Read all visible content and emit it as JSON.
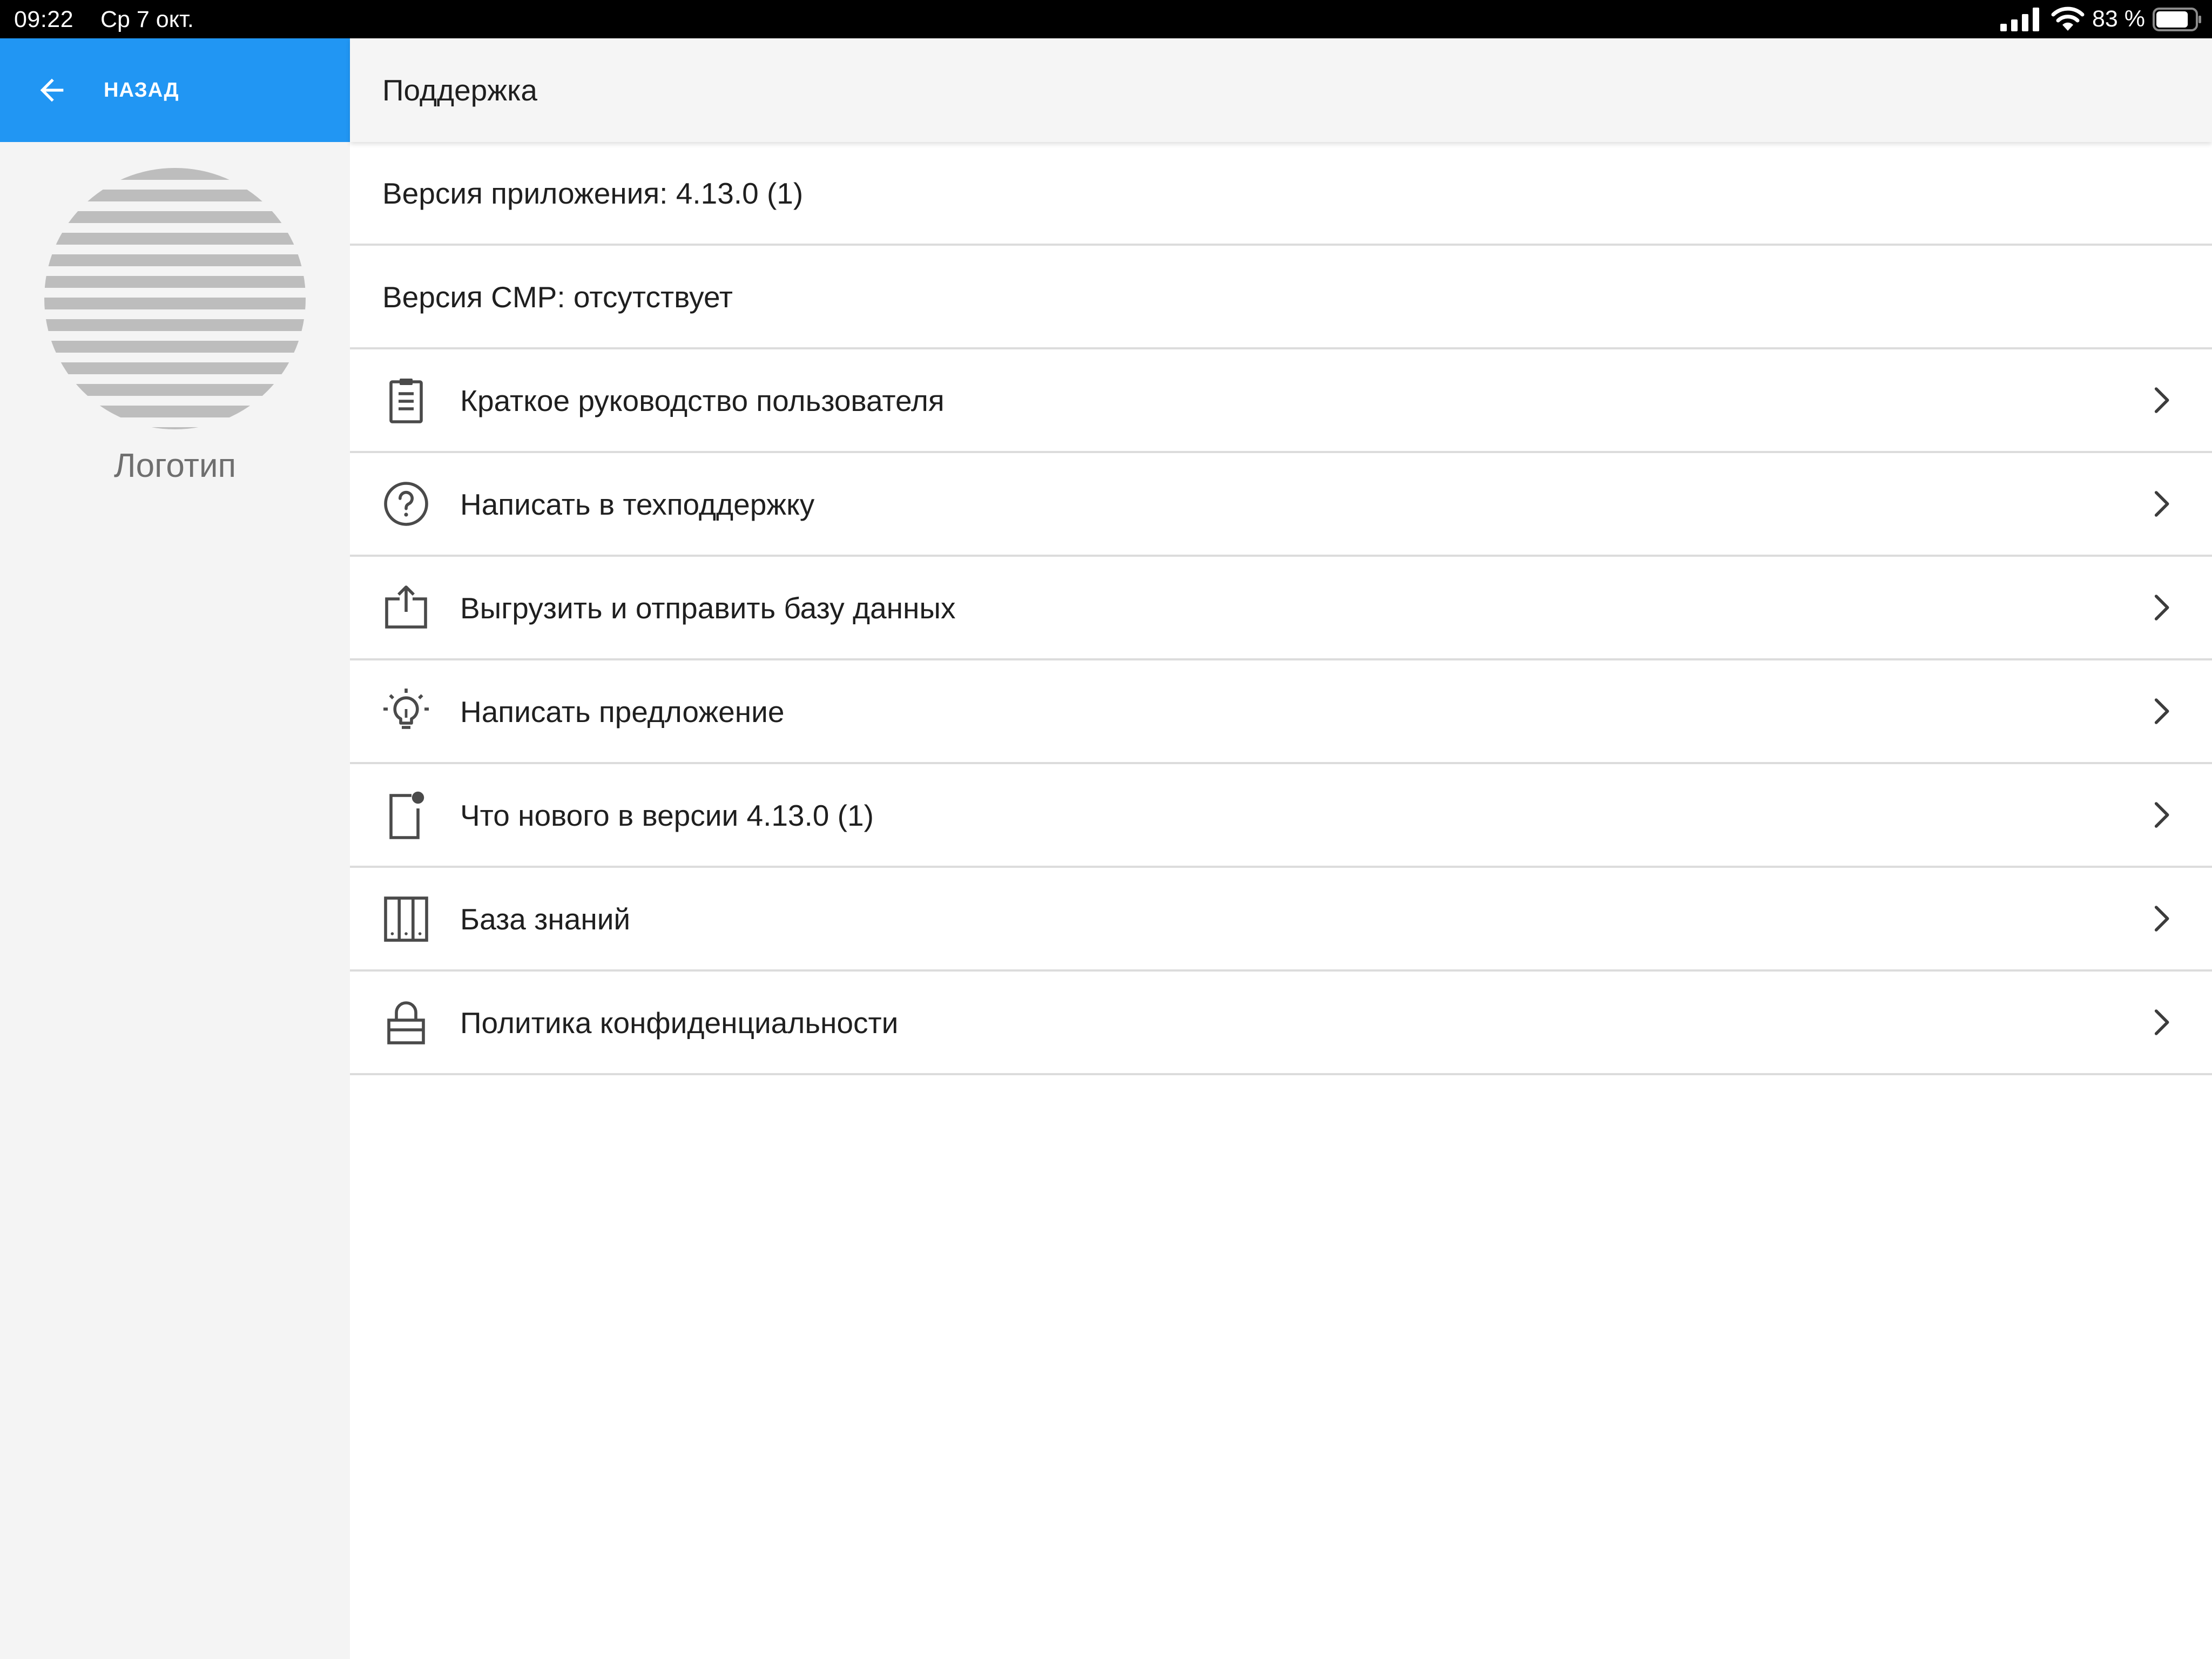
{
  "status_bar": {
    "time": "09:22",
    "date": "Ср 7 окт.",
    "battery_percent": "83 %",
    "battery_level": 0.83,
    "signal_icon": "cellular-signal-icon",
    "wifi_icon": "wifi-icon"
  },
  "sidebar": {
    "back_label": "НАЗАД",
    "back_icon": "arrow-left-icon",
    "logo_label": "Логотип",
    "back_bar_color": "#2196F3"
  },
  "header": {
    "title": "Поддержка"
  },
  "info_rows": [
    {
      "text": "Версия приложения: 4.13.0 (1)"
    },
    {
      "text": "Версия CMP: отсутствует"
    }
  ],
  "menu_items": [
    {
      "label": "Краткое руководство пользователя",
      "icon": "clipboard-icon"
    },
    {
      "label": "Написать в техподдержку",
      "icon": "help-circle-icon"
    },
    {
      "label": "Выгрузить и отправить базу данных",
      "icon": "upload-icon"
    },
    {
      "label": "Написать предложение",
      "icon": "lightbulb-icon"
    },
    {
      "label": "Что нового в версии 4.13.0 (1)",
      "icon": "whats-new-icon"
    },
    {
      "label": "База знаний",
      "icon": "library-icon"
    },
    {
      "label": "Политика конфиденциальности",
      "icon": "lock-icon"
    }
  ],
  "colors": {
    "accent": "#2196F3",
    "sidebar_bg": "#F4F4F4",
    "header_bg": "#F5F5F5",
    "divider": "#DCDCDC",
    "icon": "#4A4A4A"
  }
}
